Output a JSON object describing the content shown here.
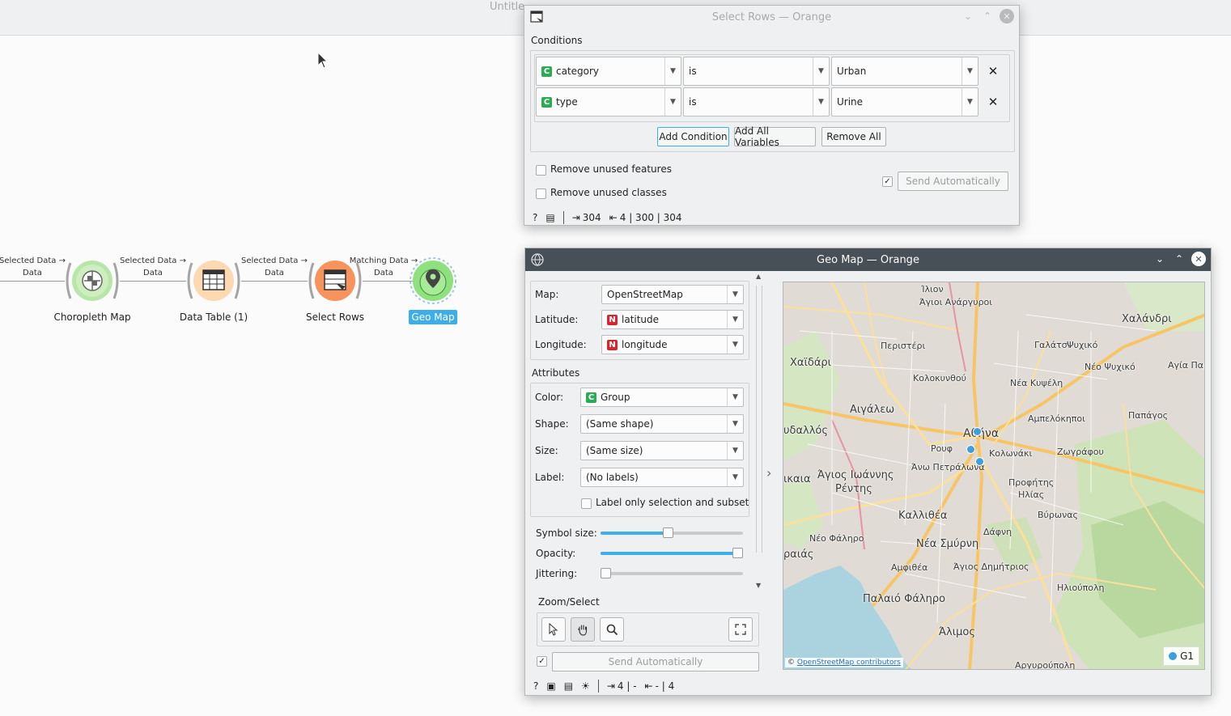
{
  "main_window": {
    "title": "Untitle"
  },
  "workflow": {
    "links": [
      {
        "label_line1": "Selected Data →",
        "label_line2": "Data"
      },
      {
        "label_line1": "Selected Data →",
        "label_line2": "Data"
      },
      {
        "label_line1": "Selected Data →",
        "label_line2": "Data"
      },
      {
        "label_line1": "Matching Data →",
        "label_line2": "Data"
      }
    ],
    "nodes": [
      {
        "label": "Choropleth Map"
      },
      {
        "label": "Data Table (1)"
      },
      {
        "label": "Select Rows"
      },
      {
        "label": "Geo Map"
      }
    ]
  },
  "select_rows": {
    "title": "Select Rows — Orange",
    "conditions_label": "Conditions",
    "conditions": [
      {
        "variable": "category",
        "var_type": "C",
        "operator": "is",
        "value": "Urban"
      },
      {
        "variable": "type",
        "var_type": "C",
        "operator": "is",
        "value": "Urine"
      }
    ],
    "add_condition": "Add Condition",
    "add_all_variables": "Add All Variables",
    "remove_all": "Remove All",
    "remove_unused_features": "Remove unused features",
    "remove_unused_classes": "Remove unused classes",
    "send_automatically": "Send Automatically",
    "status": {
      "input": "304",
      "output": "4 | 300 | 304"
    }
  },
  "geo_map": {
    "title": "Geo Map — Orange",
    "map_label": "Map:",
    "map_value": "OpenStreetMap",
    "latitude_label": "Latitude:",
    "latitude_value": "latitude",
    "longitude_label": "Longitude:",
    "longitude_value": "longitude",
    "attributes_label": "Attributes",
    "color_label": "Color:",
    "color_value": "Group",
    "shape_label": "Shape:",
    "shape_value": "(Same shape)",
    "size_label": "Size:",
    "size_value": "(Same size)",
    "label_label": "Label:",
    "label_value": "(No labels)",
    "label_only_selection": "Label only selection and subset",
    "symbol_size_label": "Symbol size:",
    "opacity_label": "Opacity:",
    "jittering_label": "Jittering:",
    "symbol_size_level": 0.47,
    "opacity_level": 1.0,
    "jittering_level": 0.0,
    "zoom_select_label": "Zoom/Select",
    "send_automatically": "Send Automatically",
    "status": {
      "input": "4 | -",
      "output": "- | 4"
    },
    "attribution_prefix": "©",
    "attribution_link": "OpenStreetMap contributors",
    "legend_label": "G1",
    "places": [
      "Ίλιον",
      "Άγιοι Ανάργυροι",
      "Περιστέρι",
      "Χαϊδάρι",
      "Κολοκυνθού",
      "Αιγάλεω",
      "Αθήνα",
      "Ρουφ",
      "Άνω Πετράλωνα",
      "Άγιος Ιωάννης",
      "Ρέντης",
      "Καλλιθέα",
      "Νέο Φάληρο",
      "Νέα Σμύρνη",
      "Δάφνη",
      "Αμφιθέα",
      "Άγιος Δημήτριος",
      "Παλαιό Φάληρο",
      "Άλιμος",
      "Ηλιούπολη",
      "Βύρωνας",
      "Προφήτης",
      "Ηλίας",
      "Ζωγράφου",
      "Κολωνάκι",
      "Αμπελόκηποι",
      "Νέα Κυψέλη",
      "Γαλάτσι",
      "Ψυχικό",
      "Νέο Ψυχικό",
      "Χαλάνδρι",
      "Αγία Παρ",
      "Παπάγος",
      "υδαλλός",
      "ικαια",
      "ραιάς",
      "Αργυρούπολη"
    ],
    "accent_color": "#3daee9",
    "point_color": "#3e9ee0"
  }
}
